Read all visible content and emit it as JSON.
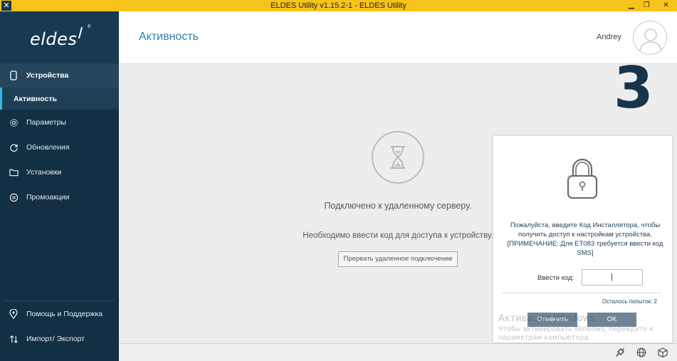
{
  "window": {
    "title": "ELDES Utility v1.15.2-1 - ELDES Utility",
    "icon": "x-logo-icon",
    "controls": [
      "minimize",
      "maximize",
      "close"
    ]
  },
  "sidebar": {
    "logo_text": "eldes",
    "logo_reg": "®",
    "items": [
      {
        "label": "Устройства",
        "icon": "device-icon",
        "active": true
      },
      {
        "label": "Активность",
        "icon": "",
        "active": true
      },
      {
        "label": "Параметры",
        "icon": "gear-icon"
      },
      {
        "label": "Обновления",
        "icon": "refresh-icon"
      },
      {
        "label": "Установки",
        "icon": "folder-icon"
      },
      {
        "label": "Промоакции",
        "icon": "promo-icon"
      }
    ],
    "bottom_items": [
      {
        "label": "Помощь и Поддержка",
        "icon": "location-pin-icon"
      },
      {
        "label": "Импорт/ Экспорт",
        "icon": "import-export-icon"
      }
    ]
  },
  "header": {
    "page_title": "Активность",
    "user_name": "Andrey"
  },
  "overlay_number": "3",
  "main": {
    "connected_message": "Подключено к удаленному серверу.",
    "need_code_message": "Необходимо ввести код для доступа к устройству.",
    "abort_button": "Прервать удаленное подключение"
  },
  "modal": {
    "instructions": "Пожалуйста, введите Код Инсталлятора, чтобы получить доступ к настройкам устройства.  [ПРИМЕЧАНИЕ: Для ET083 требуется ввести код SMS]",
    "code_label": "Ввести код:",
    "code_value": "|",
    "attempts_left": "Осталось попыток: 2",
    "cancel_button": "Отменить",
    "ok_button": "OK"
  },
  "watermark": {
    "title": "Активация Windows",
    "subtitle": "Чтобы активировать Windows, перейдите к параметрам компьютера."
  },
  "statusbar": {
    "icons": [
      "plug-icon",
      "globe-icon",
      "box-icon"
    ]
  },
  "colors": {
    "titlebar": "#f7c31a",
    "sidebar": "#122f43",
    "accent": "#2fb6e8",
    "title_blue": "#2d7fa8",
    "button": "#6f8597"
  }
}
